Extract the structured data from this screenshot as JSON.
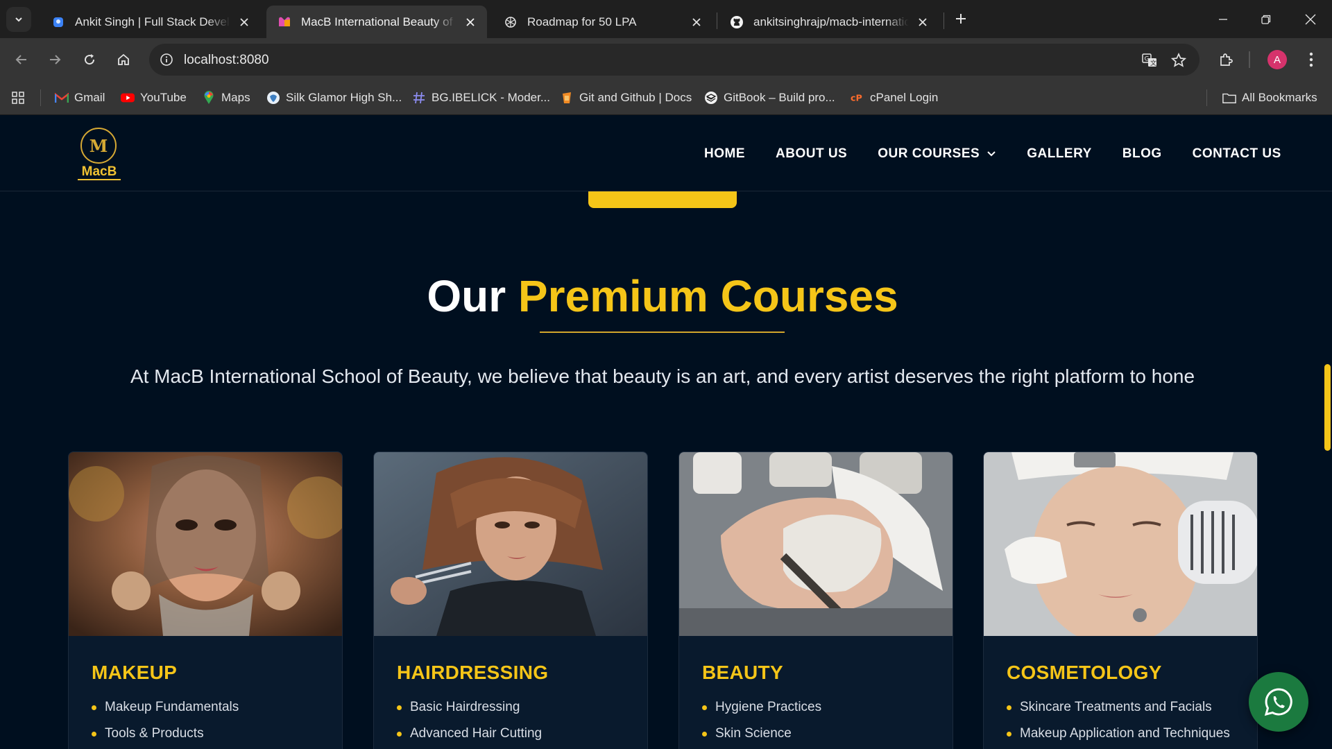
{
  "browser": {
    "tabs": [
      {
        "title": "Ankit Singh | Full Stack Develop",
        "active": false,
        "icon": "portfolio-favicon"
      },
      {
        "title": "MacB International Beauty of Sc",
        "active": true,
        "icon": "macb-favicon"
      },
      {
        "title": "Roadmap for 50 LPA",
        "active": false,
        "icon": "chatgpt-favicon"
      },
      {
        "title": "ankitsinghrajp/macb-internatior",
        "active": false,
        "icon": "github-favicon"
      }
    ],
    "url": "localhost:8080",
    "profile_initial": "A",
    "bookmarks": [
      {
        "label": "Gmail",
        "icon": "gmail-icon"
      },
      {
        "label": "YouTube",
        "icon": "youtube-icon"
      },
      {
        "label": "Maps",
        "icon": "maps-icon"
      },
      {
        "label": "Silk Glamor High Sh...",
        "icon": "silk-icon"
      },
      {
        "label": "BG.IBELICK - Moder...",
        "icon": "hash-icon"
      },
      {
        "label": "Git and Github | Docs",
        "icon": "docs-icon"
      },
      {
        "label": "GitBook – Build pro...",
        "icon": "gitbook-icon"
      },
      {
        "label": "cPanel Login",
        "icon": "cpanel-icon"
      }
    ],
    "all_bookmarks": "All Bookmarks"
  },
  "site": {
    "logo_text": "MacB",
    "logo_letter": "M",
    "nav": [
      {
        "label": "HOME"
      },
      {
        "label": "ABOUT US"
      },
      {
        "label": "OUR COURSES",
        "dropdown": true
      },
      {
        "label": "GALLERY"
      },
      {
        "label": "BLOG"
      },
      {
        "label": "CONTACT US"
      }
    ]
  },
  "section": {
    "title_plain": "Our",
    "title_highlight": "Premium Courses",
    "subtitle": "At MacB International School of Beauty, we believe that beauty is an art, and every artist deserves the right platform to hone"
  },
  "courses": [
    {
      "title": "MAKEUP",
      "items": [
        "Makeup Fundamentals",
        "Tools & Products"
      ]
    },
    {
      "title": "HAIRDRESSING",
      "items": [
        "Basic Hairdressing",
        "Advanced Hair Cutting"
      ]
    },
    {
      "title": "BEAUTY",
      "items": [
        "Hygiene Practices",
        "Skin Science"
      ]
    },
    {
      "title": "COSMETOLOGY",
      "items": [
        "Skincare Treatments and Facials",
        "Makeup Application and Techniques"
      ]
    }
  ],
  "colors": {
    "accent": "#f5c518",
    "background": "#000f1f",
    "card": "#091a2d",
    "whatsapp": "#1b7a3f"
  }
}
